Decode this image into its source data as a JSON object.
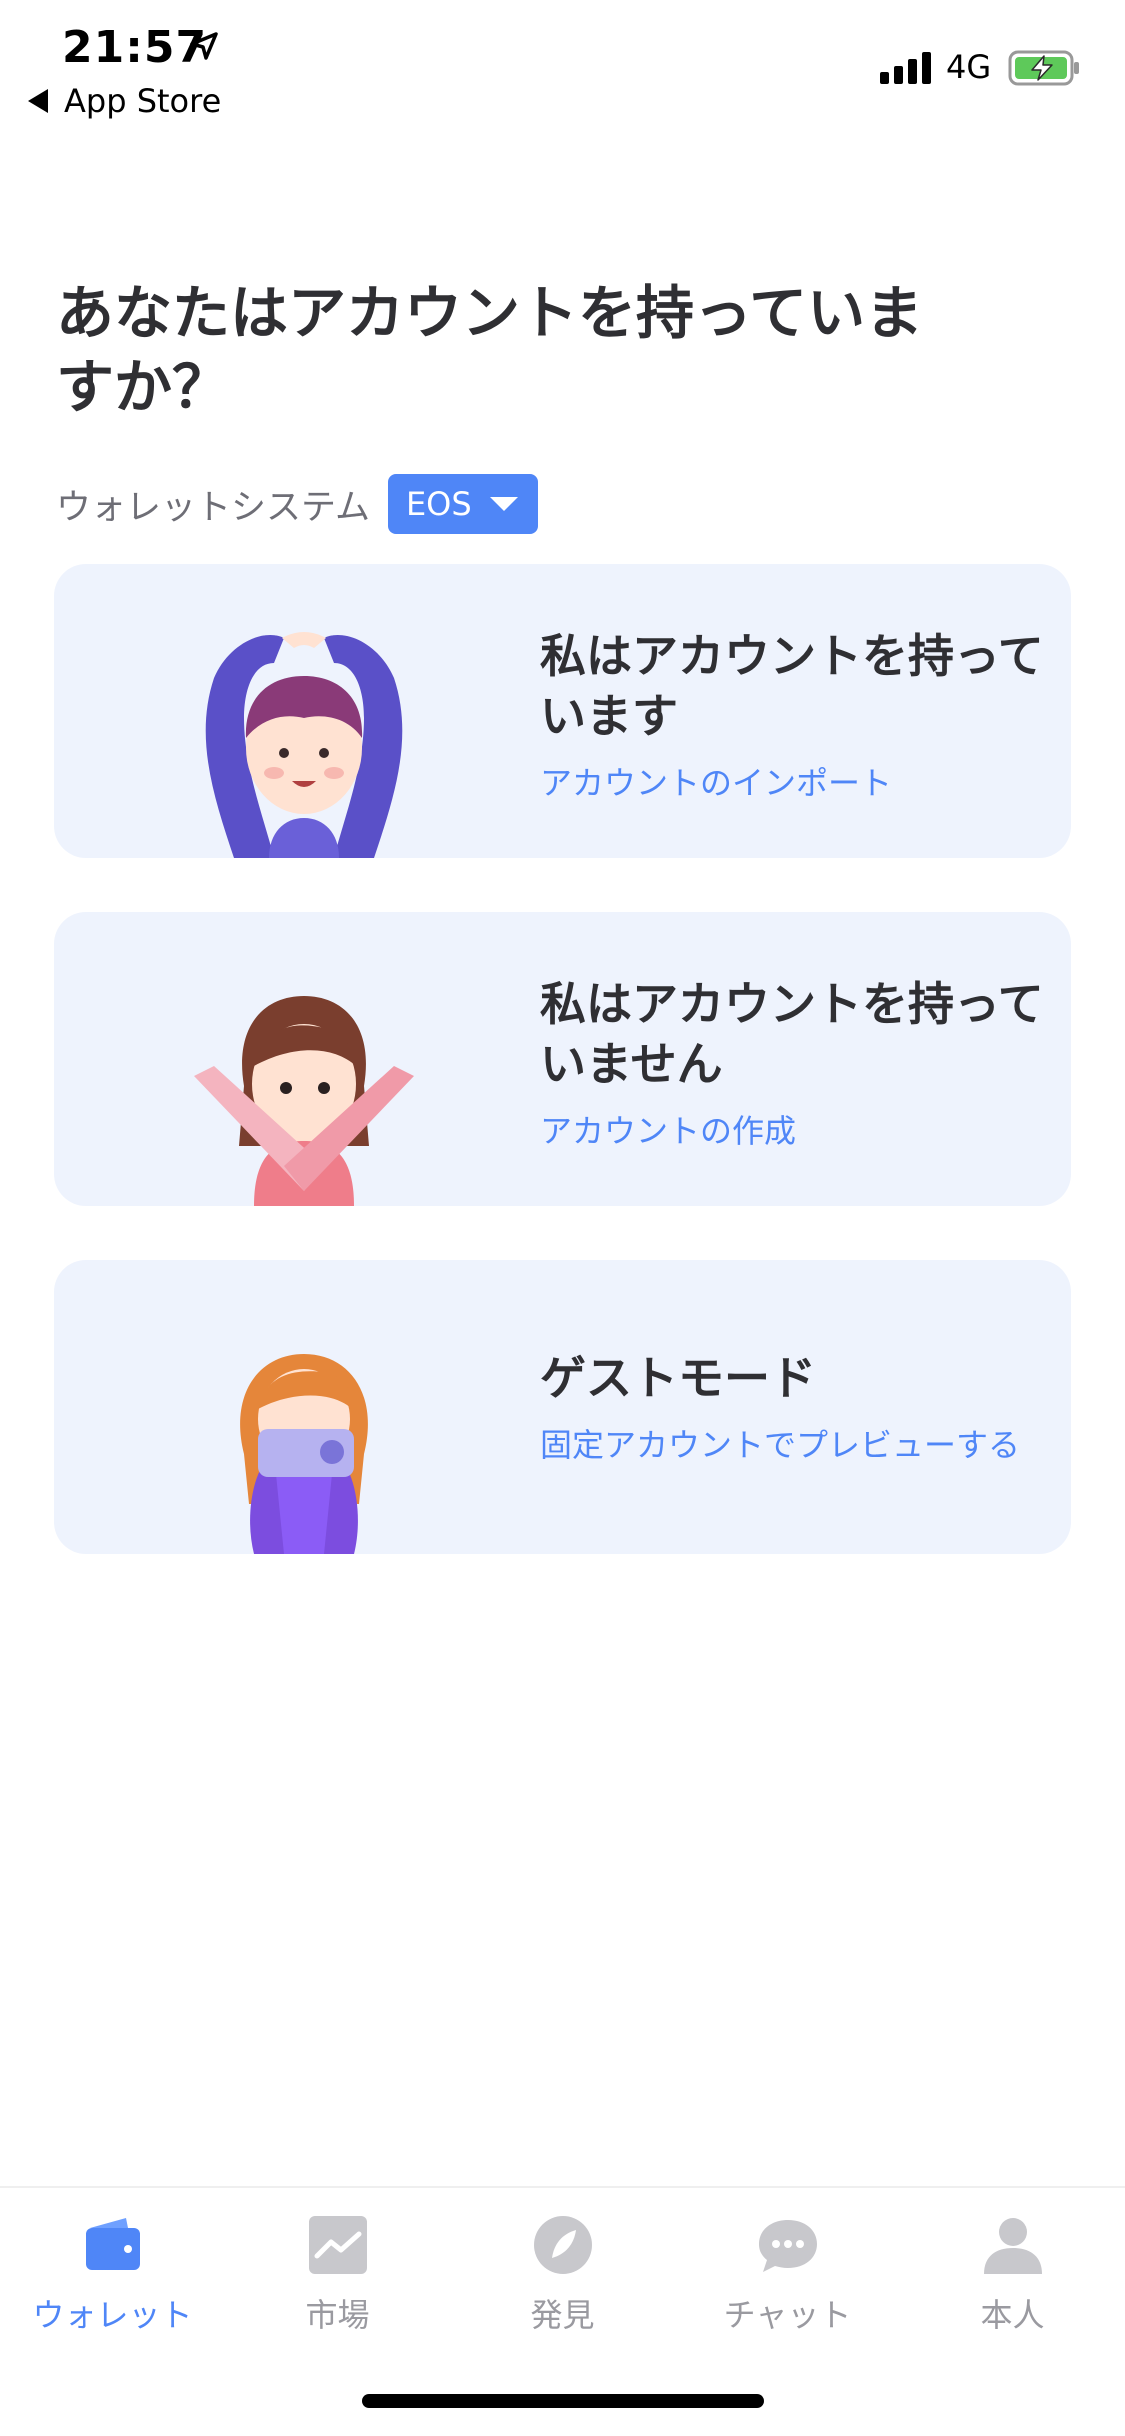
{
  "status_bar": {
    "time": "21:57",
    "back_label": "App Store",
    "network": "4G"
  },
  "header": {
    "title": "あなたはアカウントを持っていますか？"
  },
  "wallet_system": {
    "label": "ウォレットシステム",
    "selected": "EOS"
  },
  "cards": [
    {
      "title": "私はアカウントを持っています",
      "subtitle": "アカウントのインポート",
      "icon": "hands-over-head-man-illustration"
    },
    {
      "title": "私はアカウントを持っていません",
      "subtitle": "アカウントの作成",
      "icon": "crossed-arms-woman-illustration"
    },
    {
      "title": "ゲストモード",
      "subtitle": "固定アカウントでプレビューする",
      "icon": "guest-camera-woman-illustration"
    }
  ],
  "tabbar": {
    "items": [
      {
        "label": "ウォレット",
        "icon": "wallet-icon",
        "active": true
      },
      {
        "label": "市場",
        "icon": "market-chart-icon",
        "active": false
      },
      {
        "label": "発見",
        "icon": "discover-icon",
        "active": false
      },
      {
        "label": "チャット",
        "icon": "chat-bubble-icon",
        "active": false
      },
      {
        "label": "本人",
        "icon": "profile-icon",
        "active": false
      }
    ]
  },
  "colors": {
    "accent": "#4f86f7",
    "card_bg": "#eef3fd",
    "inactive": "#c8c8cc"
  }
}
